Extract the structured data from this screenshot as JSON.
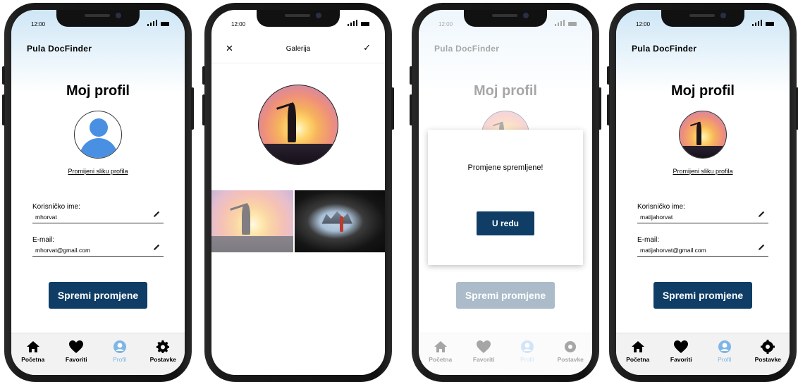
{
  "status": {
    "time": "12:00"
  },
  "app_title": "Pula DocFinder",
  "profile": {
    "title": "Moj profil",
    "change_photo": "Promijeni sliku profila",
    "username_label": "Korisničko ime:",
    "email_label": "E-mail:",
    "save_button": "Spremi promjene"
  },
  "screens": {
    "s1": {
      "username": "mhorvat",
      "email": "mhorvat@gmail.com"
    },
    "s4": {
      "username": "matijahorvat",
      "email": "matijahorvat@gmail.com"
    }
  },
  "gallery": {
    "title": "Galerija",
    "close_icon": "close-icon",
    "confirm_icon": "check-icon"
  },
  "modal": {
    "message": "Promjene spremljene!",
    "ok_button": "U redu"
  },
  "tabbar": [
    {
      "label": "Početna",
      "icon": "home-icon"
    },
    {
      "label": "Favoriti",
      "icon": "heart-icon"
    },
    {
      "label": "Profil",
      "icon": "profile-icon",
      "active": true
    },
    {
      "label": "Postavke",
      "icon": "gear-icon"
    }
  ],
  "colors": {
    "primary": "#0f3d66",
    "accent": "#4a90e2",
    "active_tab": "#7fb6e6",
    "header_gradient": "#cfe6f6"
  }
}
